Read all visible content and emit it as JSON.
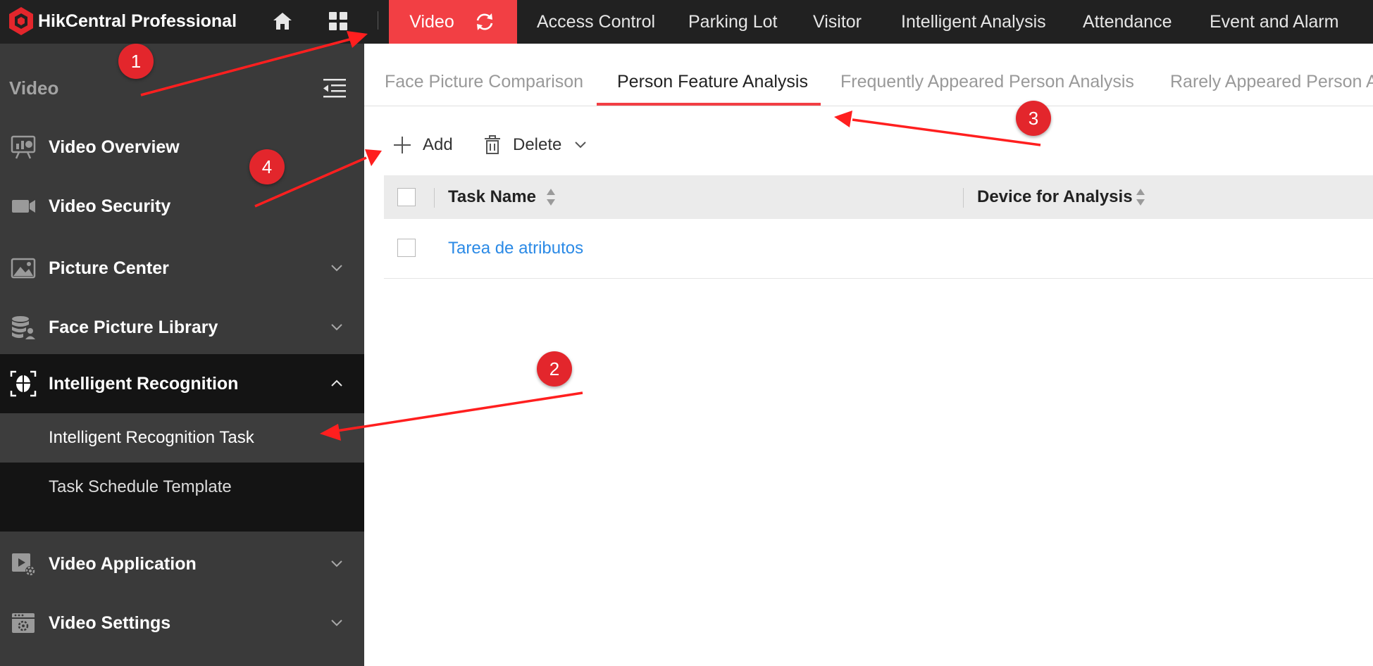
{
  "app": {
    "title": "HikCentral Professional",
    "brand_color": "#f23f44"
  },
  "topbar": {
    "home_icon": "home-icon",
    "apps_icon": "grid-icon",
    "active_module": "Video",
    "refresh_icon": "refresh-icon",
    "modules": [
      "Access Control",
      "Parking Lot",
      "Visitor",
      "Intelligent Analysis",
      "Attendance",
      "Event and Alarm"
    ]
  },
  "sidebar": {
    "title": "Video",
    "collapse_icon": "menu-collapse-icon",
    "items": [
      {
        "label": "Video Overview",
        "icon": "dashboard-icon"
      },
      {
        "label": "Video Security",
        "icon": "camera-icon"
      },
      {
        "label": "Picture Center",
        "icon": "picture-icon",
        "expandable": true
      },
      {
        "label": "Face Picture Library",
        "icon": "database-user-icon",
        "expandable": true
      },
      {
        "label": "Intelligent Recognition",
        "icon": "face-scan-icon",
        "expanded": true
      },
      {
        "label": "Video Application",
        "icon": "video-settings-icon",
        "expandable": true
      },
      {
        "label": "Video Settings",
        "icon": "settings-panel-icon",
        "expandable": true
      }
    ],
    "subitems": [
      "Intelligent Recognition Task",
      "Task Schedule Template"
    ],
    "active_subitem": "Intelligent Recognition Task"
  },
  "content": {
    "tabs": [
      "Face Picture Comparison",
      "Person Feature Analysis",
      "Frequently Appeared Person Analysis",
      "Rarely Appeared Person A"
    ],
    "active_tab": "Person Feature Analysis",
    "toolbar": {
      "add_label": "Add",
      "delete_label": "Delete"
    },
    "table": {
      "columns": [
        "Task Name",
        "Device for Analysis"
      ],
      "rows": [
        {
          "task_name": "Tarea de atributos",
          "device": ""
        }
      ]
    }
  },
  "annotations": [
    "1",
    "2",
    "3",
    "4"
  ]
}
